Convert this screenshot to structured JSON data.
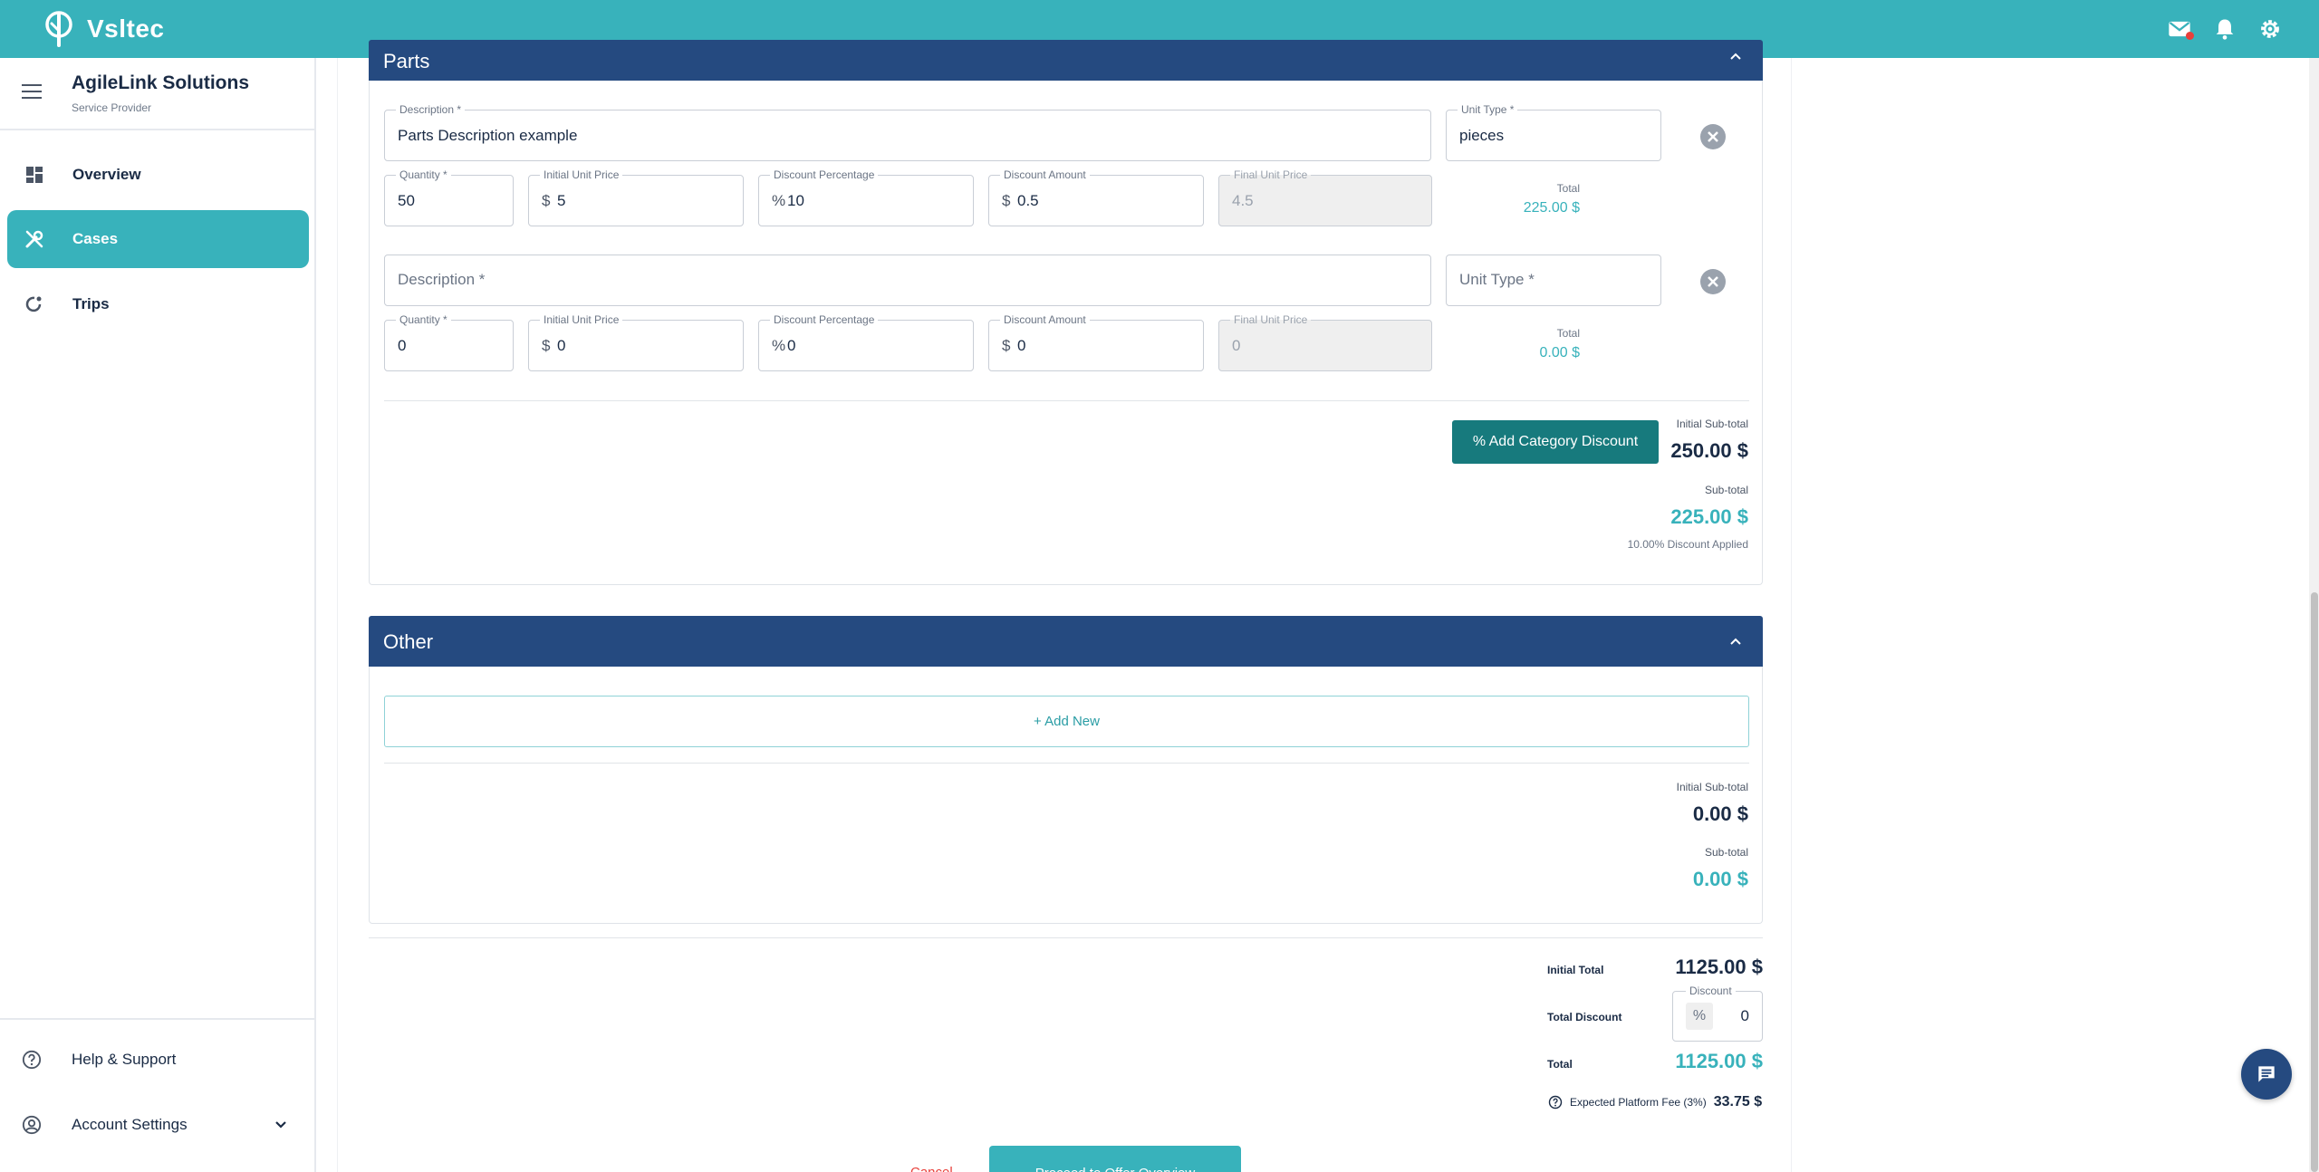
{
  "app": {
    "name": "Vsltec"
  },
  "colors": {
    "accent": "#38b2bb",
    "navy": "#254a80",
    "danger": "#e8403b",
    "button_dark": "#177a7d"
  },
  "topbar": {
    "icons": [
      "mail-icon",
      "bell-icon",
      "gear-icon"
    ]
  },
  "sidebar": {
    "org_name": "AgileLink Solutions",
    "org_role": "Service Provider",
    "items": [
      {
        "label": "Overview",
        "icon": "dashboard-icon",
        "active": false
      },
      {
        "label": "Cases",
        "icon": "tools-icon",
        "active": true
      },
      {
        "label": "Trips",
        "icon": "route-icon",
        "active": false
      }
    ],
    "bottom": [
      {
        "label": "Help & Support",
        "icon": "help-icon"
      },
      {
        "label": "Account Settings",
        "icon": "account-icon"
      }
    ]
  },
  "parts": {
    "title": "Parts",
    "items": [
      {
        "description_label": "Description *",
        "description": "Parts Description example",
        "unit_type_label": "Unit Type *",
        "unit_type": "pieces",
        "quantity_label": "Quantity *",
        "quantity": "50",
        "initial_unit_price_label": "Initial Unit Price",
        "initial_unit_price": "5",
        "discount_percentage_label": "Discount Percentage",
        "discount_percentage": "10",
        "discount_amount_label": "Discount Amount",
        "discount_amount": "0.5",
        "final_unit_price_label": "Final Unit Price",
        "final_unit_price": "4.5",
        "total_label": "Total",
        "total": "225.00 $"
      },
      {
        "description_placeholder": "Description *",
        "unit_type_placeholder": "Unit Type *",
        "quantity_label": "Quantity *",
        "quantity": "0",
        "initial_unit_price_label": "Initial Unit Price",
        "initial_unit_price": "0",
        "discount_percentage_label": "Discount Percentage",
        "discount_percentage": "0",
        "discount_amount_label": "Discount Amount",
        "discount_amount": "0",
        "final_unit_price_label": "Final Unit Price",
        "final_unit_price": "0",
        "total_label": "Total",
        "total": "0.00 $"
      }
    ],
    "currency_prefix": "$",
    "percent_prefix": "%",
    "add_category_discount": "% Add Category Discount",
    "initial_subtotal_label": "Initial Sub-total",
    "initial_subtotal": "250.00 $",
    "subtotal_label": "Sub-total",
    "subtotal": "225.00 $",
    "discount_note": "10.00% Discount Applied"
  },
  "other": {
    "title": "Other",
    "add_new": "+ Add New",
    "initial_subtotal_label": "Initial Sub-total",
    "initial_subtotal": "0.00 $",
    "subtotal_label": "Sub-total",
    "subtotal": "0.00 $"
  },
  "totals": {
    "initial_total_label": "Initial Total",
    "initial_total": "1125.00 $",
    "total_discount_label": "Total Discount",
    "discount_field_label": "Discount",
    "discount_prefix": "%",
    "discount_value": "0",
    "total_label": "Total",
    "total": "1125.00 $",
    "platform_fee_label": "Expected Platform Fee (3%)",
    "platform_fee": "33.75 $"
  },
  "actions": {
    "cancel": "Cancel",
    "proceed": "Proceed to Offer Overview"
  }
}
